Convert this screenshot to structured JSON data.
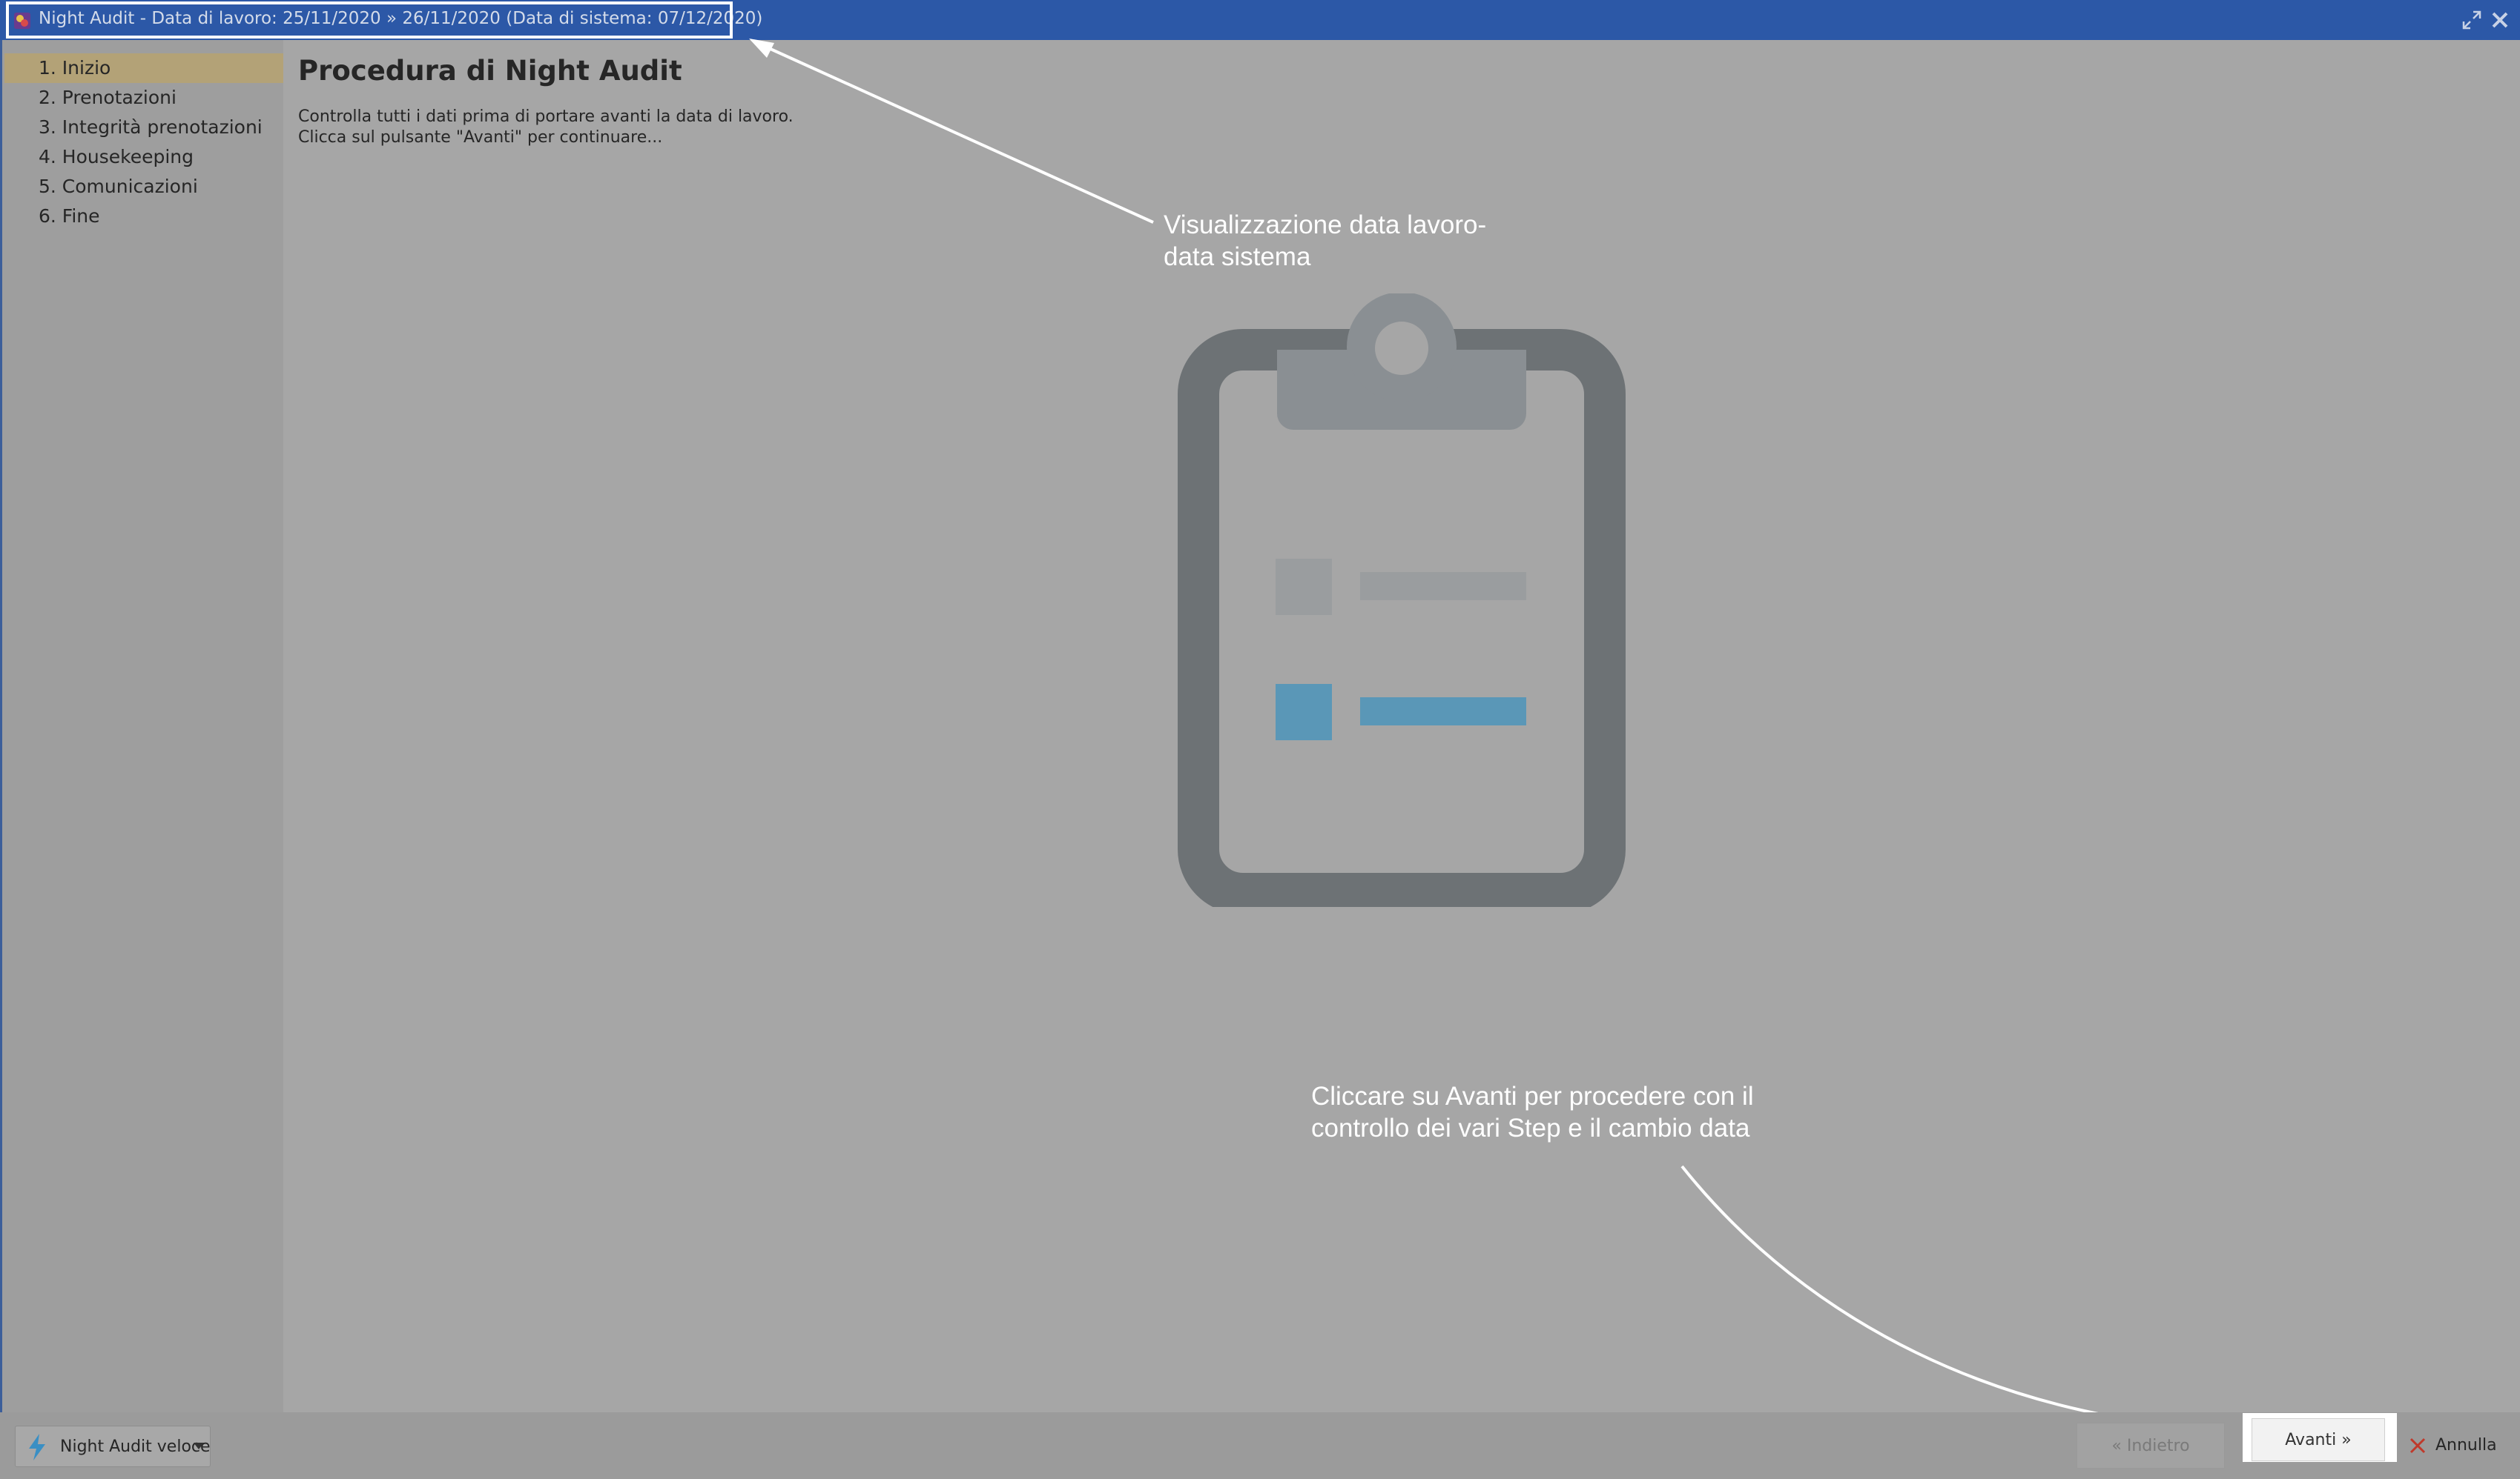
{
  "window": {
    "title": "Night Audit - Data di lavoro: 25/11/2020 » 26/11/2020 (Data di sistema: 07/12/2020)",
    "icon": "night-audit-app-icon",
    "controls": [
      "maximize-icon",
      "close-icon"
    ]
  },
  "sidebar": {
    "items": [
      {
        "label": "1. Inizio",
        "active": true
      },
      {
        "label": "2. Prenotazioni",
        "active": false
      },
      {
        "label": "3. Integrità prenotazioni",
        "active": false
      },
      {
        "label": "4. Housekeeping",
        "active": false
      },
      {
        "label": "5. Comunicazioni",
        "active": false
      },
      {
        "label": "6. Fine",
        "active": false
      }
    ]
  },
  "main": {
    "title": "Procedura di Night Audit",
    "description": [
      "Controlla tutti i dati prima di portare avanti la data di lavoro.",
      "Clicca sul pulsante \"Avanti\" per continuare..."
    ],
    "illustration": "clipboard-checklist-icon"
  },
  "annotations": {
    "date_note": [
      "Visualizzazione data lavoro-",
      "data sistema"
    ],
    "next_note": [
      "Cliccare su Avanti per procedere con il",
      "controllo dei vari Step e il cambio data"
    ]
  },
  "footer": {
    "fast_audit_label": "Night Audit veloce",
    "back_label": "« Indietro",
    "next_label": "Avanti »",
    "cancel_label": "Annulla"
  },
  "colors": {
    "titlebar": "#2c58a7",
    "active_item": "#b3a277",
    "clipboard_frame": "#6d7275",
    "clipboard_accent": "#5a97b7",
    "cancel_x": "#c0392b",
    "bolt": "#3a8fc4"
  }
}
